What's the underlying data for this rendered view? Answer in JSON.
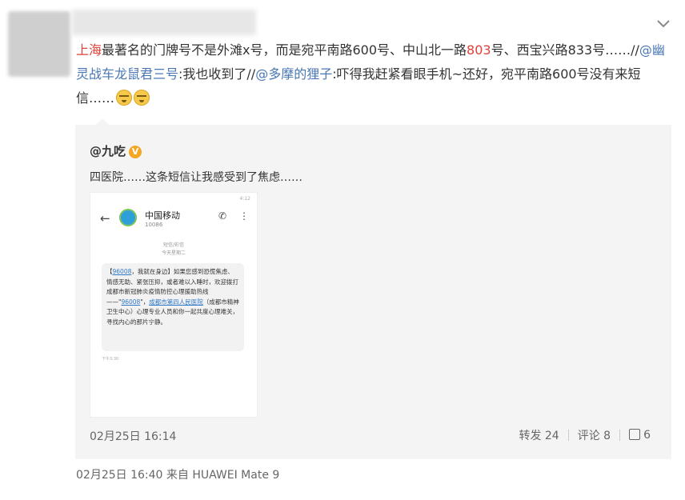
{
  "post": {
    "seg_city": "上海",
    "seg1": "最著名的门牌号不是外滩x号，而是宛平南路600号、中山北一路",
    "seg_803": "803",
    "seg2": "号、西宝兴路833号……//",
    "mention1": "@幽灵战车龙鼠君三号",
    "seg3": ":我也收到了//",
    "mention2": "@多摩的狸子",
    "seg4": ":吓得我赶紧看眼手机~还好，宛平南路600号没有来短信……"
  },
  "repost": {
    "user": "@九吃",
    "verified": "V",
    "text": "四医院……这条短信让我感受到了焦虑……",
    "phone": {
      "status_right": "4:12",
      "sender_name": "中国移动",
      "sender_number": "10086",
      "meta1": "短信/彩信",
      "meta2": "今天星期二",
      "msg_a": "【",
      "msg_link1": "96008",
      "msg_b": "，我就在身边】如果您感到恐慌焦虑、情感无助、紧张压抑，或者难以入睡时，欢迎拨打成都市新冠肺炎疫情防控心理援助热线——\"",
      "msg_link2": "96008",
      "msg_c": "\"，",
      "msg_link3": "成都市第四人民医院",
      "msg_d": "（成都市精神卫生中心）心理专业人员和你一起共度心理难关，寻找内心的那片宁静。",
      "time": "下午3:30"
    },
    "date": "02月25日 16:14",
    "repost_label": "转发 24",
    "comment_label": "评论 8",
    "like_count": "6"
  },
  "footer": "02月25日 16:40  来自 HUAWEI Mate 9"
}
